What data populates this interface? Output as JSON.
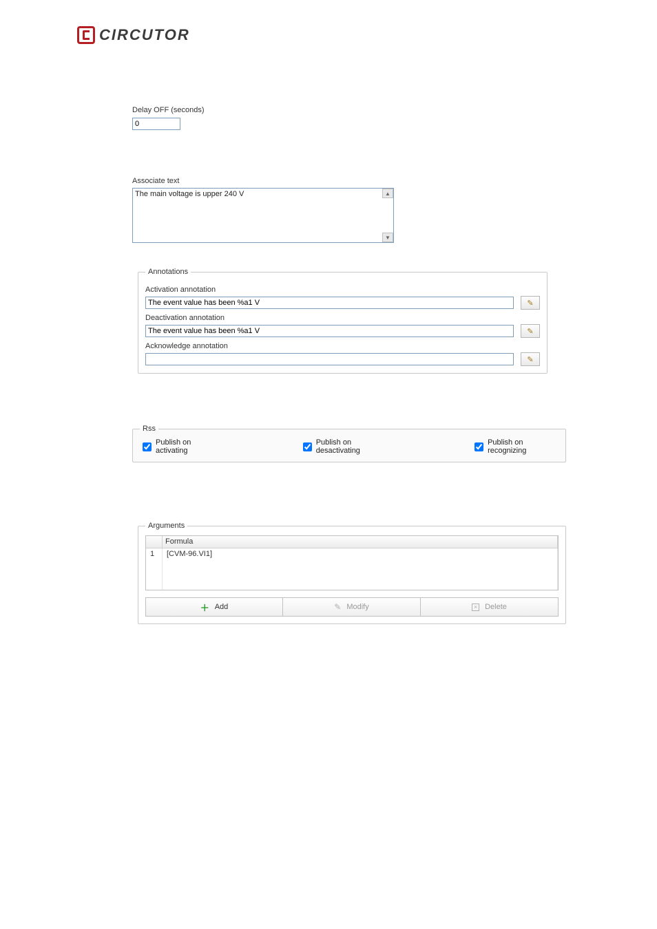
{
  "brand": {
    "name": "CIRCUTOR"
  },
  "delay": {
    "label": "Delay OFF (seconds)",
    "value": "0"
  },
  "associate": {
    "label": "Associate text",
    "value": "The main voltage is upper 240 V"
  },
  "annotations": {
    "legend": "Annotations",
    "activation": {
      "label": "Activation annotation",
      "value": "The event value has been %a1 V"
    },
    "deactivation": {
      "label": "Deactivation annotation",
      "value": "The event value has been %a1 V"
    },
    "acknowledge": {
      "label": "Acknowledge annotation",
      "value": ""
    }
  },
  "rss": {
    "legend": "Rss",
    "activating": "Publish on activating",
    "deactivating": "Publish on desactivating",
    "recognizing": "Publish on recognizing"
  },
  "arguments": {
    "legend": "Arguments",
    "headers": {
      "index": "",
      "formula": "Formula"
    },
    "rows": [
      {
        "index": "1",
        "formula": "[CVM-96.VI1]"
      }
    ],
    "buttons": {
      "add": "Add",
      "modify": "Modify",
      "delete": "Delete"
    }
  }
}
